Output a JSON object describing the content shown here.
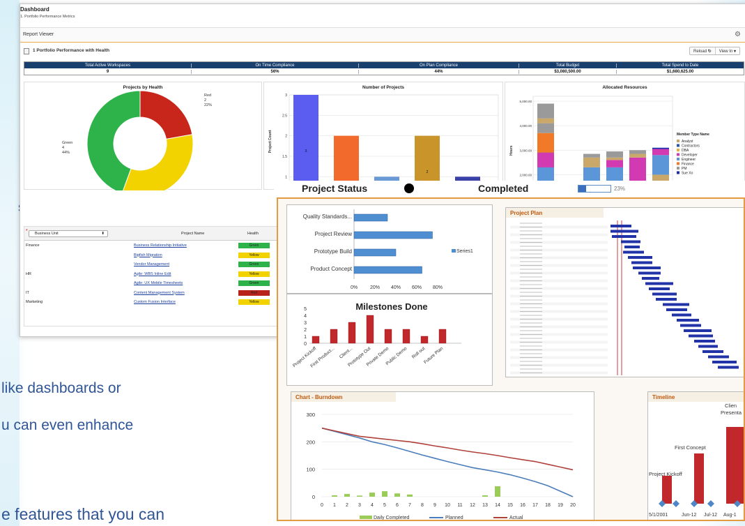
{
  "bg": {
    "line1": "s:",
    "line2": "like  dashboards  or",
    "line3": "u can even enhance",
    "line4": "e features that you can"
  },
  "dashboard": {
    "title": "Dashboard",
    "subtitle": "1. Portfolio Performance Metrics",
    "viewer_label": "Report Viewer",
    "report_title": "1 Portfolio Performance with Health",
    "reload_label": "Reload",
    "view_label": "View In",
    "kpis": [
      {
        "label": "Total Active Workspaces",
        "value": "9"
      },
      {
        "label": "On Time Compliance",
        "value": "56%"
      },
      {
        "label": "On Plan Compliance",
        "value": "44%"
      },
      {
        "label": "Total Budget",
        "value": "$3,080,500.00"
      },
      {
        "label": "Total Spend to Date",
        "value": "$1,680,625.00"
      }
    ],
    "table": {
      "filter": "Business Unit",
      "col_project": "Project Name",
      "col_health": "Health",
      "rows": [
        {
          "group": "Finance",
          "project": "Business Relationship Initiative",
          "health": "Green"
        },
        {
          "group": "",
          "project": "Bigfish Migration",
          "health": "Yellow"
        },
        {
          "group": "",
          "project": "Vendor Management",
          "health": "Green"
        },
        {
          "group": "HR",
          "project": "Agile: WBS Inline Edit",
          "health": "Yellow"
        },
        {
          "group": "",
          "project": "Agile: UX Mobile Timesheets",
          "health": "Green"
        },
        {
          "group": "IT",
          "project": "Content Management System",
          "health": "Red"
        },
        {
          "group": "Marketing",
          "project": "Custom Fusion Interface",
          "health": "Yellow"
        }
      ]
    }
  },
  "project_status": {
    "label": "Project Status",
    "completed_label": "Completed",
    "completed_pct_text": "23%",
    "completed_value": 0.23
  },
  "chart_data": [
    {
      "type": "pie",
      "title": "Projects by Health",
      "slices": [
        {
          "label": "Red",
          "value": 2,
          "pct": "22%",
          "color": "#c8261b"
        },
        {
          "label": "Yellow",
          "value": 3,
          "pct": "33%",
          "color": "#f2d300"
        },
        {
          "label": "Green",
          "value": 4,
          "pct": "44%",
          "color": "#2db34a"
        }
      ]
    },
    {
      "type": "bar",
      "title": "Number of Projects",
      "ylabel": "Project Count",
      "ylim": [
        0,
        3
      ],
      "yticks": [
        "1",
        "1.5",
        "2",
        "2.5",
        "3"
      ],
      "values": [
        3,
        2,
        1,
        2,
        1
      ],
      "bar_labels": [
        "3",
        "",
        "",
        "2",
        ""
      ],
      "colors": [
        "#5b5cf0",
        "#f26a2c",
        "#6a9ad6",
        "#c9952a",
        "#3940a8"
      ]
    },
    {
      "type": "bar",
      "title": "Allocated Resources",
      "ylabel": "Hours",
      "yticks": [
        "2,000.00",
        "3,000.00",
        "4,000.00",
        "5,000.00"
      ],
      "legend_title": "Member Type Name",
      "legend": [
        {
          "name": "Analyst",
          "color": "#c9a86a"
        },
        {
          "name": "Contractors",
          "color": "#2a55a8"
        },
        {
          "name": "DBA",
          "color": "#e2b340"
        },
        {
          "name": "Developer",
          "color": "#d13ab0"
        },
        {
          "name": "Engineer",
          "color": "#5b97d8"
        },
        {
          "name": "Finance",
          "color": "#f07a28"
        },
        {
          "name": "PM",
          "color": "#9a9a9a"
        },
        {
          "name": "Sue Xo",
          "color": "#1a2fb0"
        }
      ]
    },
    {
      "type": "bar",
      "series_label": "Series1",
      "categories": [
        "Quality Standards...",
        "Project Review",
        "Prototype Build",
        "Product Concept"
      ],
      "values": [
        0.32,
        0.75,
        0.4,
        0.65
      ],
      "xticks": [
        "0%",
        "20%",
        "40%",
        "60%",
        "80%"
      ]
    },
    {
      "type": "bar",
      "title": "Milestones Done",
      "yticks": [
        "0",
        "1",
        "2",
        "3",
        "4",
        "5"
      ],
      "categories": [
        "Project Kickoff",
        "First Product...",
        "Client...",
        "Prototype Out",
        "Private Demo",
        "Public Demo",
        "Roll out",
        "Future Plan"
      ],
      "values": [
        1,
        2,
        3,
        4,
        2,
        2,
        1,
        2
      ]
    },
    {
      "type": "table",
      "title": "Project Plan"
    },
    {
      "type": "line",
      "title": "Chart - Burndown",
      "yticks": [
        "0",
        "100",
        "200",
        "300"
      ],
      "x": [
        0,
        1,
        2,
        3,
        4,
        5,
        6,
        7,
        8,
        9,
        10,
        11,
        12,
        13,
        14,
        15,
        16,
        17,
        18,
        19,
        20
      ],
      "series": [
        {
          "name": "Daily Completed",
          "type": "bar",
          "values": [
            0,
            5,
            10,
            4,
            15,
            20,
            12,
            8,
            0,
            0,
            0,
            0,
            0,
            5,
            38,
            0,
            0,
            0,
            0,
            0,
            0
          ]
        },
        {
          "name": "Planned",
          "values": [
            250,
            238,
            226,
            214,
            200,
            190,
            178,
            165,
            152,
            140,
            128,
            117,
            106,
            98,
            90,
            80,
            68,
            55,
            40,
            20,
            0
          ]
        },
        {
          "name": "Actual",
          "values": [
            250,
            240,
            230,
            220,
            215,
            210,
            205,
            200,
            193,
            185,
            178,
            170,
            163,
            157,
            150,
            142,
            135,
            128,
            118,
            108,
            98
          ]
        }
      ]
    },
    {
      "type": "bar",
      "title": "Timeline",
      "labels": [
        "Project Kickoff",
        "First Concept",
        "Pr",
        "Clien",
        "Presenta"
      ],
      "xticks": [
        "5/1/2001",
        "Jun-12",
        "Jul-12",
        "Aug-1"
      ]
    }
  ]
}
